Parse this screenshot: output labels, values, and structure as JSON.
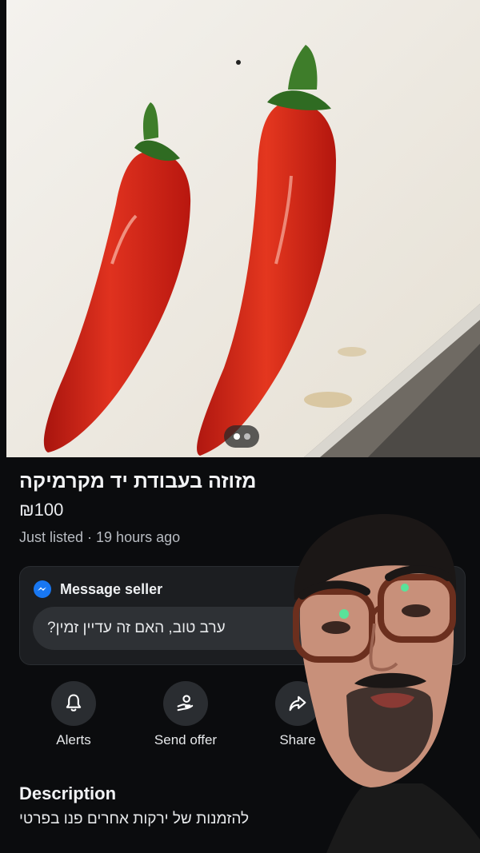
{
  "listing": {
    "title": "מזוזה בעבודת יד מקרמיקה",
    "price": "₪100",
    "listed": "Just listed · 19 hours ago"
  },
  "carousel": {
    "current": 1,
    "total": 2
  },
  "message": {
    "header": "Message seller",
    "input_value": "ערב טוב, האם זה עדיין זמין?"
  },
  "actions": [
    {
      "label": "Alerts",
      "icon": "bell-icon"
    },
    {
      "label": "Send offer",
      "icon": "offer-icon"
    },
    {
      "label": "Share",
      "icon": "share-icon"
    }
  ],
  "description": {
    "heading": "Description",
    "text": "להזמנות של ירקות אחרים פנו בפרטי"
  },
  "colors": {
    "background": "#0b0c0e",
    "card": "#1c1e21",
    "input": "#2e3135",
    "messenger": "#1877f2",
    "pepper": "#d9261c"
  }
}
